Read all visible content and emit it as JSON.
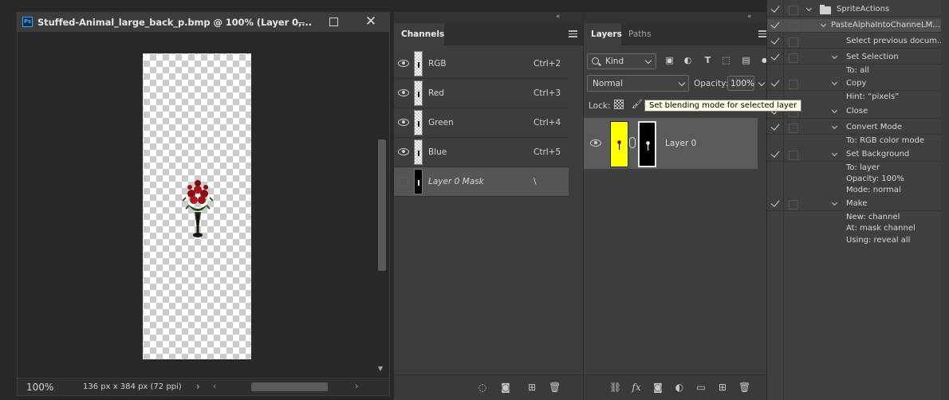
{
  "document": {
    "title": "Stuffed-Animal_large_back_p.bmp @ 100% (Layer 0,...",
    "app_icon_label": "Ps",
    "zoom": "100%",
    "doc_size": "136 px x 384 px (72 ppi)",
    "status_arrow": "›"
  },
  "channels": {
    "tab_label": "Channels",
    "collapse": "«",
    "rows": [
      {
        "name": "RGB",
        "shortcut": "Ctrl+2"
      },
      {
        "name": "Red",
        "shortcut": "Ctrl+3"
      },
      {
        "name": "Green",
        "shortcut": "Ctrl+4"
      },
      {
        "name": "Blue",
        "shortcut": "Ctrl+5"
      },
      {
        "name": "Layer 0 Mask",
        "shortcut": "\\"
      }
    ]
  },
  "layers": {
    "tabs": [
      "Layers",
      "Paths"
    ],
    "collapse": "«",
    "kind_label": "Kind",
    "blend_mode": "Normal",
    "opacity_label": "Opacity:",
    "opacity_value": "100%",
    "lock_label": "Lock:",
    "tooltip": "Set blending mode for selected layer",
    "layer_name": "Layer 0",
    "colors": {
      "layer_thumb": "#ffff00",
      "selected_row": "#5a5a5a"
    }
  },
  "actions": {
    "rows": [
      {
        "text": "SpriteActions",
        "check": true,
        "level": 0,
        "folder": true
      },
      {
        "text": "PasteAlphaIntoChanneLM...",
        "check": true,
        "level": 1
      },
      {
        "text": "Select previous docum...",
        "check": true,
        "level": 2
      },
      {
        "text": "Set Selection",
        "check": true,
        "level": 2,
        "expandable": true
      },
      {
        "text": "To: all",
        "check": false,
        "level": 3
      },
      {
        "text": "Copy",
        "check": true,
        "level": 2,
        "expandable": true
      },
      {
        "text": "Hint: “pixels”",
        "check": false,
        "level": 3
      },
      {
        "text": "Close",
        "check": true,
        "level": 2,
        "expandable": true
      },
      {
        "text": "Convert Mode",
        "check": true,
        "level": 2,
        "expandable": true
      },
      {
        "text": "To: RGB color mode",
        "check": false,
        "level": 3
      },
      {
        "text": "Set Background",
        "check": true,
        "level": 2,
        "expandable": true
      },
      {
        "text": "To: layer",
        "check": false,
        "level": 3
      },
      {
        "text": "Opacity: 100%",
        "check": false,
        "level": 3
      },
      {
        "text": "Mode: normal",
        "check": false,
        "level": 3
      },
      {
        "text": "Make",
        "check": true,
        "level": 2,
        "expandable": true
      },
      {
        "text": "New: channel",
        "check": false,
        "level": 3
      },
      {
        "text": "At: mask channel",
        "check": false,
        "level": 3
      },
      {
        "text": "Using: reveal all",
        "check": false,
        "level": 3
      }
    ]
  }
}
